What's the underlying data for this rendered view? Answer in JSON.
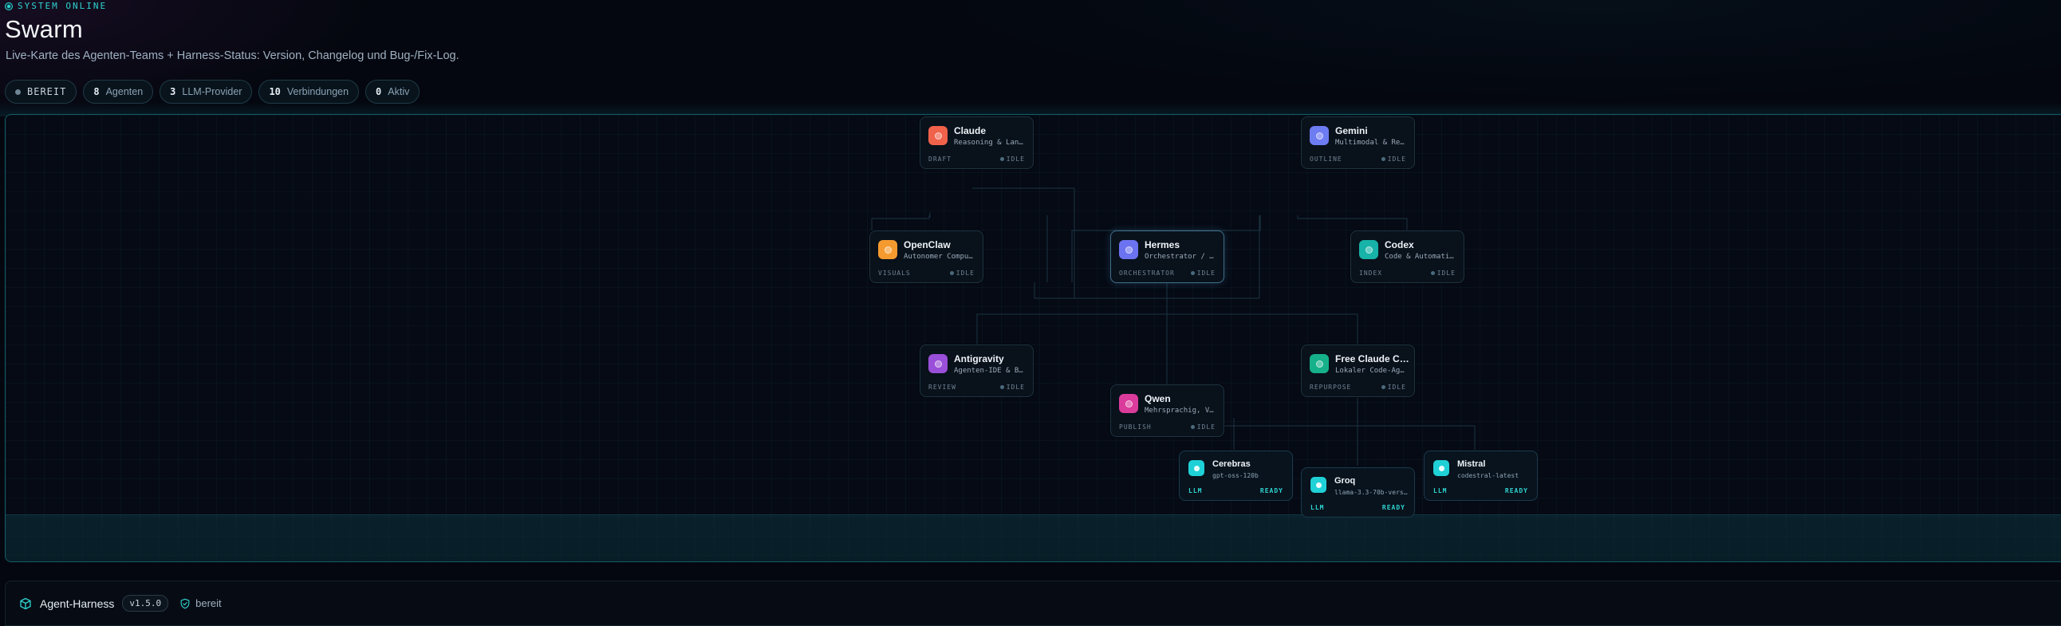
{
  "header": {
    "status": "SYSTEM ONLINE",
    "title": "Swarm",
    "subtitle": "Live-Karte des Agenten-Teams + Harness-Status: Version, Changelog und Bug-/Fix-Log."
  },
  "stats": {
    "state": "BEREIT",
    "agents_count": "8",
    "agents_label": "Agenten",
    "providers_count": "3",
    "providers_label": "LLM-Provider",
    "connections_count": "10",
    "connections_label": "Verbindungen",
    "active_count": "0",
    "active_label": "Aktiv"
  },
  "agents": {
    "claude": {
      "name": "Claude",
      "desc": "Reasoning & Lang…",
      "role": "DRAFT",
      "state": "IDLE",
      "color": "#f0624a"
    },
    "gemini": {
      "name": "Gemini",
      "desc": "Multimodal & Rec…",
      "role": "OUTLINE",
      "state": "IDLE",
      "color": "#6e7cf2"
    },
    "openclaw": {
      "name": "OpenClaw",
      "desc": "Autonomer Comput…",
      "role": "VISUALS",
      "state": "IDLE",
      "color": "#f59a2f"
    },
    "hermes": {
      "name": "Hermes",
      "desc": "Orchestrator / C…",
      "role": "ORCHESTRATOR",
      "state": "IDLE",
      "color": "#6c73f0"
    },
    "codex": {
      "name": "Codex",
      "desc": "Code & Automatis…",
      "role": "INDEX",
      "state": "IDLE",
      "color": "#17b2a8"
    },
    "antigravity": {
      "name": "Antigravity",
      "desc": "Agenten-IDE & Bu…",
      "role": "REVIEW",
      "state": "IDLE",
      "color": "#9a4fd8"
    },
    "freeclaude": {
      "name": "Free Claude Co…",
      "desc": "Lokaler Code-Age…",
      "role": "REPURPOSE",
      "state": "IDLE",
      "color": "#16b18a"
    },
    "qwen": {
      "name": "Qwen",
      "desc": "Mehrsprachig, Vi…",
      "role": "PUBLISH",
      "state": "IDLE",
      "color": "#db3c9c"
    }
  },
  "llms": {
    "cerebras": {
      "name": "Cerebras",
      "model": "gpt-oss-120b",
      "kind": "LLM",
      "state": "READY"
    },
    "groq": {
      "name": "Groq",
      "model": "llama-3.3-70b-vers…",
      "kind": "LLM",
      "state": "READY"
    },
    "mistral": {
      "name": "Mistral",
      "model": "codestral-latest",
      "kind": "LLM",
      "state": "READY"
    }
  },
  "footer": {
    "name": "Agent-Harness",
    "version": "v1.5.0",
    "status": "bereit"
  },
  "colors": {
    "accent": "#2fd3d0",
    "background": "#04070f",
    "edge": "#1c3444"
  }
}
